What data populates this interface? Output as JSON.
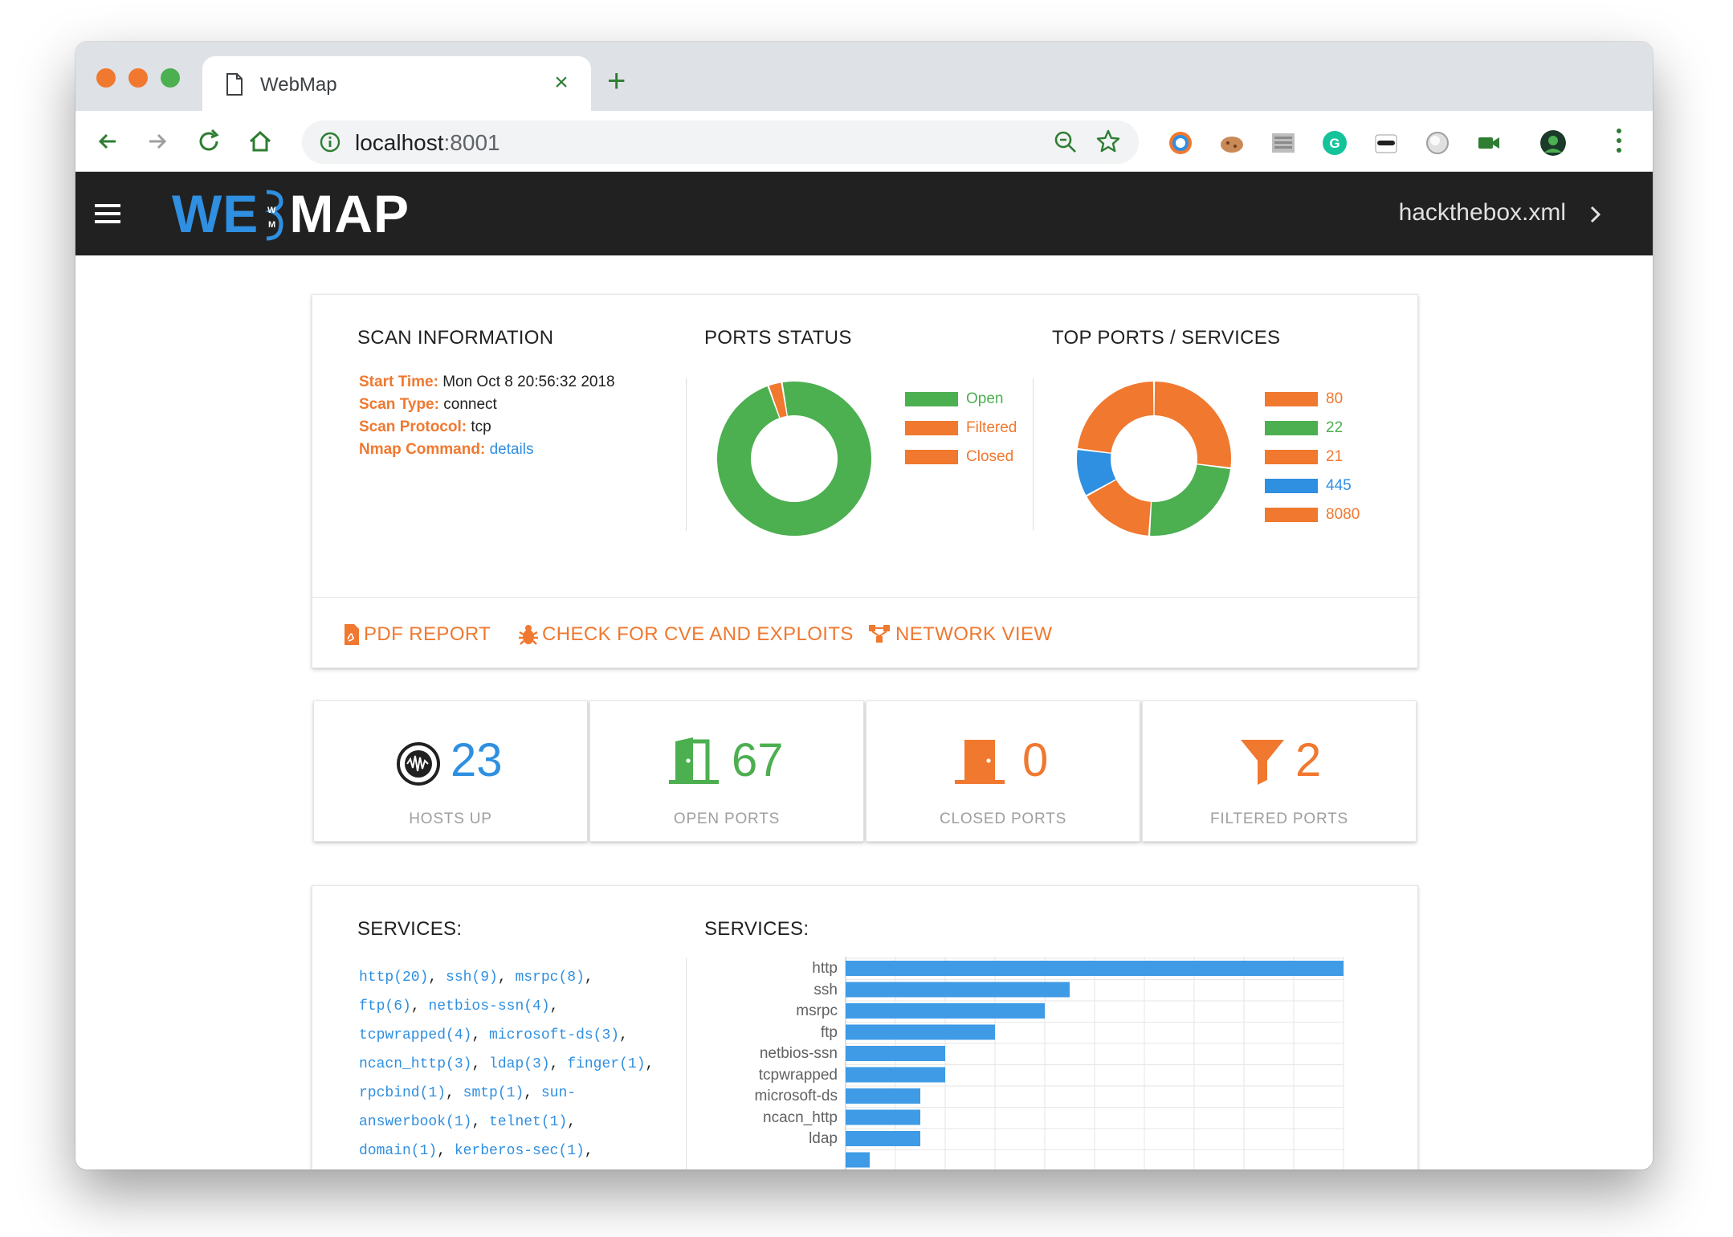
{
  "browser": {
    "tab_title": "WebMap",
    "url_host": "localhost",
    "url_port": ":8001"
  },
  "app": {
    "logo_left": "WE",
    "logo_right": "MAP",
    "filename": "hackthebox.xml"
  },
  "scan_info": {
    "title": "SCAN INFORMATION",
    "start_time_label": "Start Time:",
    "start_time": "Mon Oct 8 20:56:32 2018",
    "scan_type_label": "Scan Type:",
    "scan_type": "connect",
    "scan_protocol_label": "Scan Protocol:",
    "scan_protocol": "tcp",
    "nmap_command_label": "Nmap Command:",
    "nmap_command_link": "details"
  },
  "ports_status": {
    "title": "PORTS STATUS",
    "legend": [
      "Open",
      "Filtered",
      "Closed"
    ]
  },
  "top_ports": {
    "title": "TOP PORTS / SERVICES",
    "legend": [
      "80",
      "22",
      "21",
      "445",
      "8080"
    ]
  },
  "actions": {
    "pdf": "PDF REPORT",
    "cve": "CHECK FOR CVE AND EXPLOITS",
    "network": "NETWORK VIEW"
  },
  "stats": {
    "hosts_up": {
      "value": "23",
      "label": "HOSTS UP"
    },
    "open_ports": {
      "value": "67",
      "label": "OPEN PORTS"
    },
    "closed_ports": {
      "value": "0",
      "label": "CLOSED PORTS"
    },
    "filtered_ports": {
      "value": "2",
      "label": "FILTERED PORTS"
    }
  },
  "services": {
    "list_title": "SERVICES:",
    "chart_title": "SERVICES:",
    "list": [
      "http(20)",
      "ssh(9)",
      "msrpc(8)",
      "ftp(6)",
      "netbios-ssn(4)",
      "tcpwrapped(4)",
      "microsoft-ds(3)",
      "ncacn_http(3)",
      "ldap(3)",
      "finger(1)",
      "rpcbind(1)",
      "smtp(1)",
      "sun-answerbook(1)",
      "telnet(1)",
      "domain(1)",
      "kerberos-sec(1)"
    ]
  },
  "colors": {
    "accent_orange": "#f0782f",
    "accent_green": "#4caf50",
    "accent_blue": "#2f8fe0",
    "header_dark": "#212121"
  },
  "chart_data": [
    {
      "type": "pie",
      "title": "PORTS STATUS",
      "labels": [
        "Open",
        "Filtered",
        "Closed"
      ],
      "values": [
        67,
        2,
        0
      ],
      "colors": [
        "#4caf50",
        "#f0782f",
        "#f0782f"
      ]
    },
    {
      "type": "pie",
      "title": "TOP PORTS / SERVICES",
      "labels": [
        "80",
        "22",
        "21",
        "445",
        "8080"
      ],
      "values": [
        27,
        24,
        16,
        10,
        23
      ],
      "colors": [
        "#f0782f",
        "#4caf50",
        "#f0782f",
        "#2f8fe0",
        "#f0782f"
      ]
    },
    {
      "type": "bar",
      "title": "SERVICES:",
      "orientation": "horizontal",
      "categories": [
        "http",
        "ssh",
        "msrpc",
        "ftp",
        "netbios-ssn",
        "tcpwrapped",
        "microsoft-ds",
        "ncacn_http",
        "ldap"
      ],
      "values": [
        20,
        9,
        8,
        6,
        4,
        4,
        3,
        3,
        3
      ],
      "xlim": [
        0,
        20
      ],
      "grid": true,
      "color": "#3f9be6"
    }
  ]
}
